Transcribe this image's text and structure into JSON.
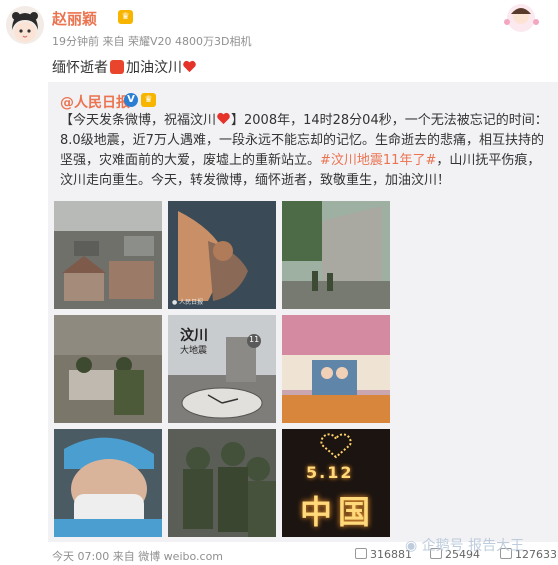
{
  "post": {
    "author": "赵丽颖",
    "meta": "19分钟前 来自 荣耀V20 4800万3D相机",
    "text_a": "缅怀逝者",
    "text_b": "加油汶川"
  },
  "repost": {
    "author": "@人民日报",
    "text_a": "【今天发条微博，祝福汶川",
    "text_b": "】2008年，14时28分04秒，一个无法被忘记的时间：8.0级地震，近7万人遇难，一段永远不能忘却的记忆。生命逝去的悲痛，相互扶持的坚强，灾难面前的大爱，废墟上的重新站立。",
    "topic": "#汶川地震11年了#",
    "text_c": "，山川抚平伤痕，汶川走向重生。今天，转发微博，缅怀逝者，致敬重生，加油汶川！",
    "image_overlay_title": "汶川",
    "image_overlay_sub": "大地震",
    "image_overlay_num": "11",
    "candle_text_top": "5.12",
    "candle_text_bottom": "中国"
  },
  "footer": {
    "time": "今天 07:00 来自 微博 weibo.com",
    "repost_count": "316881",
    "comment_count": "25494",
    "like_count": "127633"
  },
  "watermark": "企鹅号 报告大王",
  "icons": [
    "vip-crown-icon",
    "verified-v-icon",
    "heart-icon",
    "repost-icon",
    "comment-icon",
    "like-icon",
    "penguin-icon"
  ]
}
